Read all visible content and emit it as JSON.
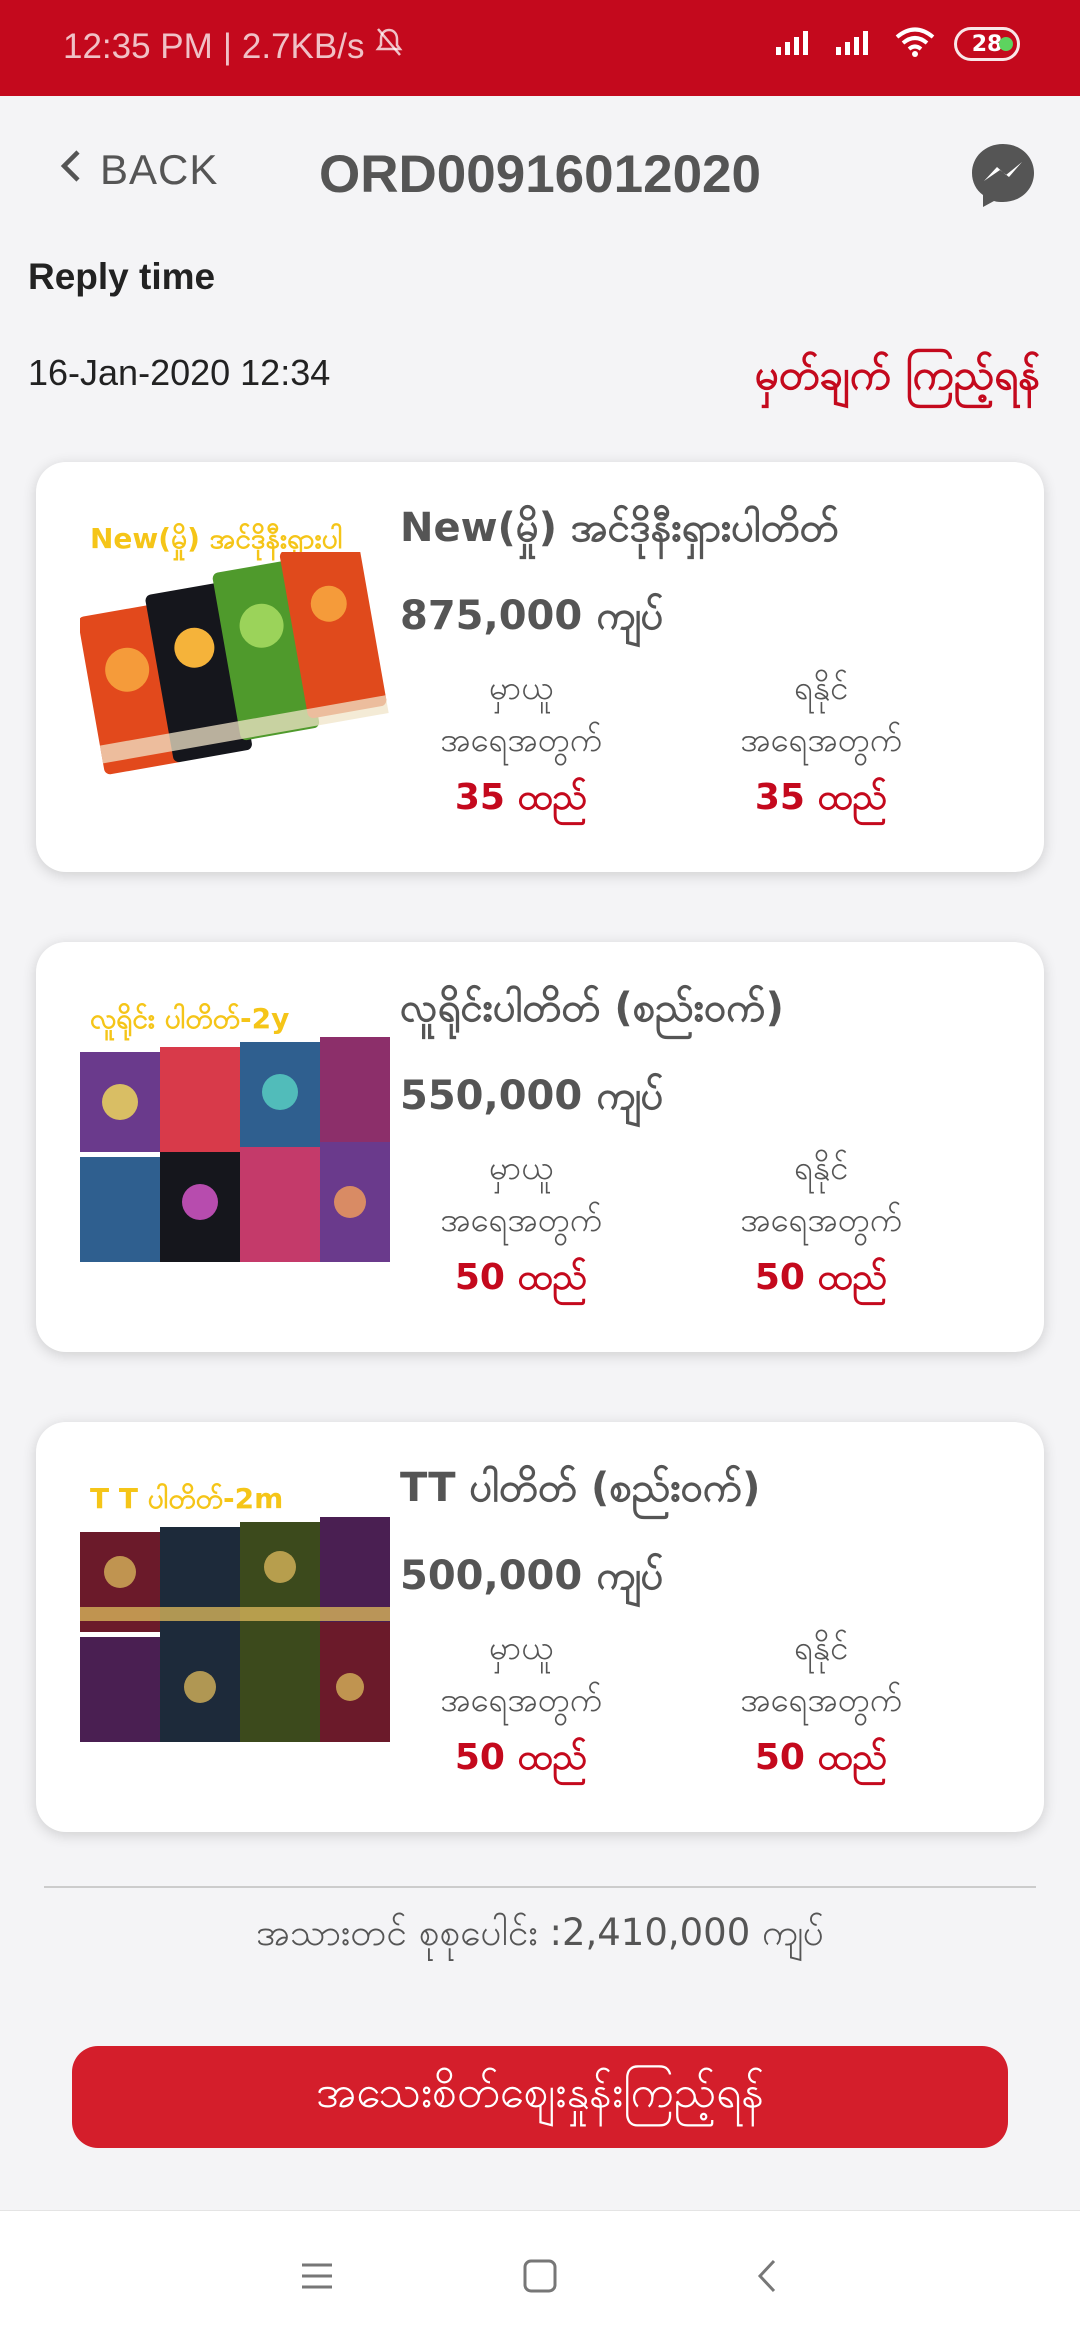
{
  "status_bar": {
    "time": "12:35 PM",
    "speed": "2.7KB/s",
    "battery": "28",
    "icons": [
      "bell-off-icon",
      "signal-icon",
      "signal-icon",
      "wifi-icon",
      "battery-icon"
    ]
  },
  "header": {
    "back_label": "BACK",
    "title": "ORD00916012020",
    "right_icon": "messenger-icon"
  },
  "reply": {
    "label": "Reply time",
    "datetime": "16-Jan-2020 12:34",
    "detail_link": "မှတ်ချက် ကြည့်ရန်"
  },
  "products": [
    {
      "image_caption": "New(မှို) အင်ဒိုနီးရှားပါ",
      "name": "New(မှို) အင်ဒိုနီးရှားပါတိတ်",
      "price": "875,000 ကျပ်",
      "col1_label1": "မှာယူ",
      "col1_label2": "အရေအတွက်",
      "col1_qty": "35 ထည်",
      "col2_label1": "ရနိုင်",
      "col2_label2": "အရေအတွက်",
      "col2_qty": "35 ထည်",
      "colors": [
        "#e2491c",
        "#15161c",
        "#4f9a2c",
        "#e04a1c"
      ]
    },
    {
      "image_caption": "လူရိုင်း ပါတိတ်-2y",
      "name": "လူရိုင်းပါတိတ် (စည်းဝက်)",
      "price": "550,000 ကျပ်",
      "col1_label1": "မှာယူ",
      "col1_label2": "အရေအတွက်",
      "col1_qty": "50 ထည်",
      "col2_label1": "ရနိုင်",
      "col2_label2": "အရေအတွက်",
      "col2_qty": "50 ထည်",
      "colors": [
        "#6a3a8c",
        "#d83a4a",
        "#2f5f8f",
        "#8c2f6a"
      ]
    },
    {
      "image_caption": "T T ပါတိတ်-2m",
      "name": "TT ပါတိတ် (စည်းဝက်)",
      "price": "500,000 ကျပ်",
      "col1_label1": "မှာယူ",
      "col1_label2": "အရေအတွက်",
      "col1_qty": "50 ထည်",
      "col2_label1": "ရနိုင်",
      "col2_label2": "အရေအတွက်",
      "col2_qty": "50 ထည်",
      "colors": [
        "#6b1a2a",
        "#1d2a3a",
        "#3c4a1c",
        "#4a1f52"
      ]
    }
  ],
  "total_text": "အသားတင် စုစုပေါင်း :2,410,000 ကျပ်",
  "primary_button": "အသေးစိတ်စျေးနှုန်းကြည့်ရန်",
  "nav": [
    "menu-icon",
    "home-square-icon",
    "back-arrow-icon"
  ],
  "theme": {
    "accent": "#c4091d",
    "button": "#d41e2b"
  }
}
